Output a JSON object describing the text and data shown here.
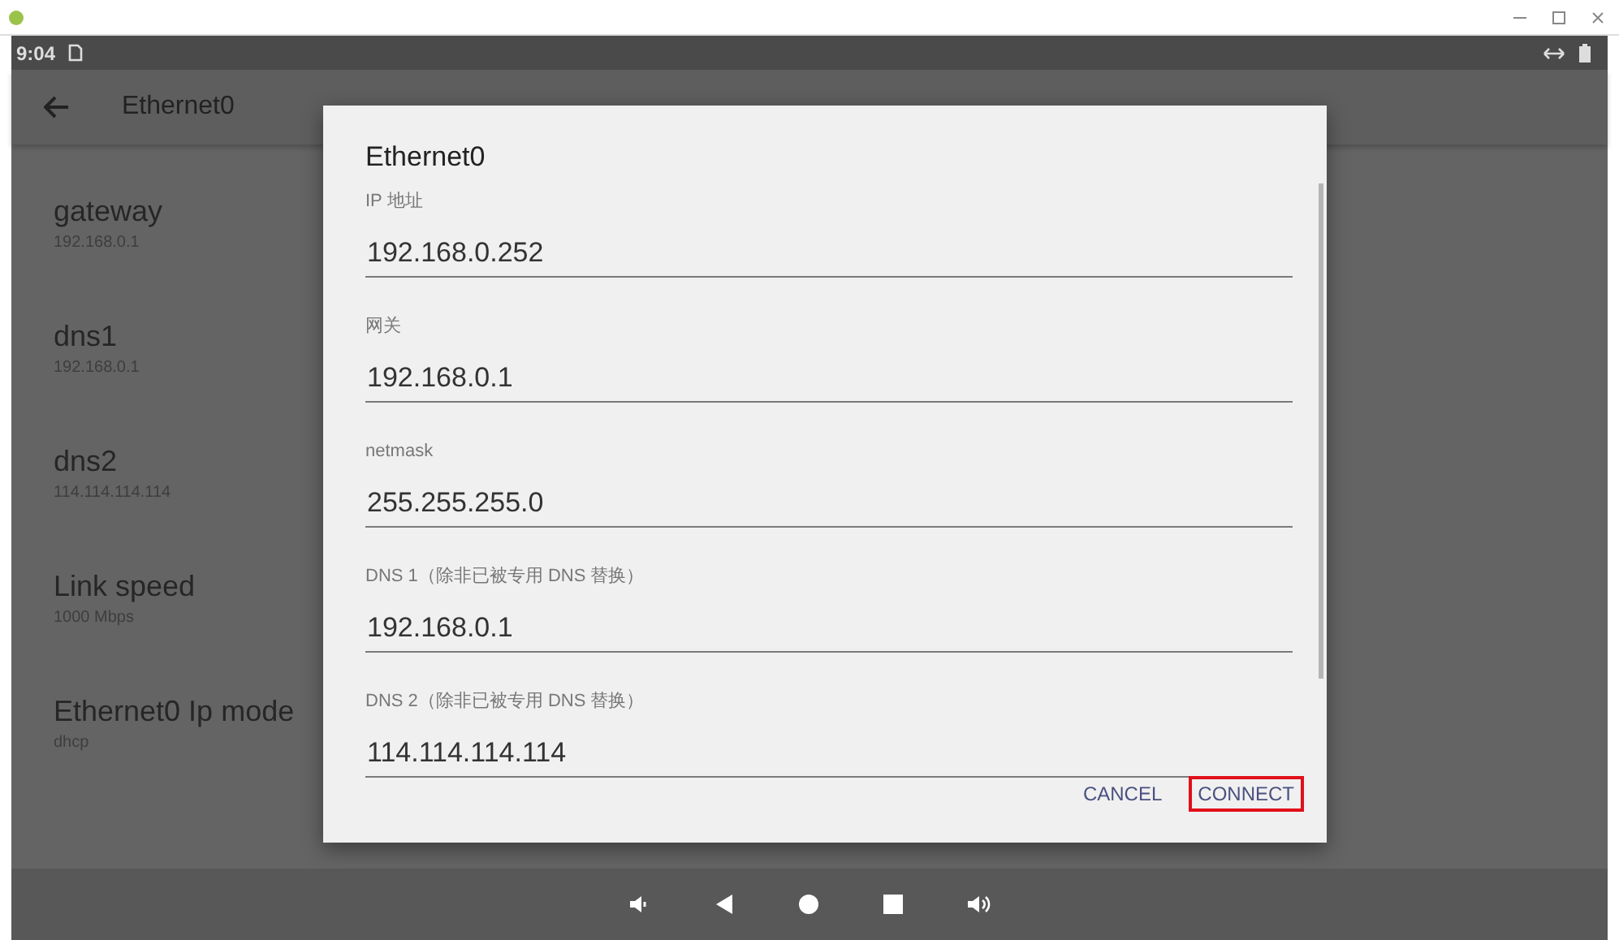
{
  "status_bar": {
    "time": "9:04"
  },
  "app_bar": {
    "title": "Ethernet0"
  },
  "settings": [
    {
      "title": "gateway",
      "value": "192.168.0.1"
    },
    {
      "title": "dns1",
      "value": "192.168.0.1"
    },
    {
      "title": "dns2",
      "value": "114.114.114.114"
    },
    {
      "title": "Link speed",
      "value": "1000 Mbps"
    },
    {
      "title": "Ethernet0 Ip mode",
      "value": "dhcp"
    }
  ],
  "dialog": {
    "title": "Ethernet0",
    "fields": [
      {
        "label": "IP 地址",
        "value": "192.168.0.252"
      },
      {
        "label": "网关",
        "value": "192.168.0.1"
      },
      {
        "label": "netmask",
        "value": "255.255.255.0"
      },
      {
        "label": "DNS 1（除非已被专用 DNS 替换）",
        "value": "192.168.0.1"
      },
      {
        "label": "DNS 2（除非已被专用 DNS 替换）",
        "value": "114.114.114.114"
      }
    ],
    "buttons": [
      {
        "label": "CANCEL",
        "highlighted": false
      },
      {
        "label": "CONNECT",
        "highlighted": true
      }
    ]
  }
}
